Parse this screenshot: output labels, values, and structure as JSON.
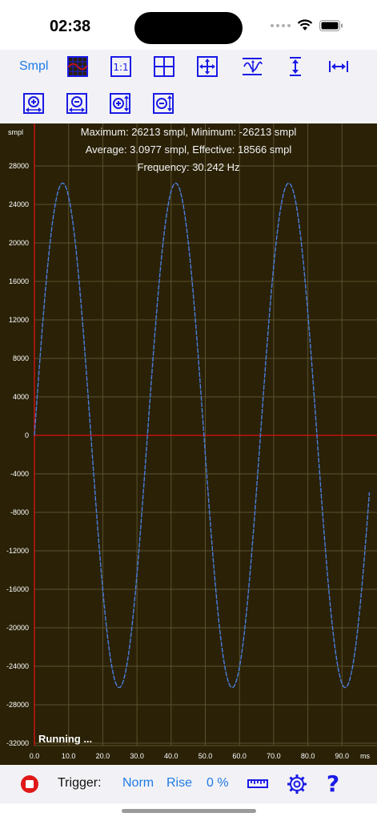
{
  "status": {
    "time": "02:38"
  },
  "toolbar": {
    "units_label": "Smpl"
  },
  "plot": {
    "unit_label": "smpl",
    "x_unit_label": "ms",
    "info_line_1": "Maximum: 26213 smpl, Minimum: -26213 smpl",
    "info_line_2": "Average: 3.0977 smpl, Effective: 18566 smpl",
    "info_line_3": "Frequency: 30.242 Hz",
    "status_text": "Running ..."
  },
  "bottom": {
    "trigger_label": "Trigger:",
    "mode": "Norm",
    "edge": "Rise",
    "level": "0 %"
  },
  "colors": {
    "background": "#2a2106",
    "grid": "#5a5230",
    "axis": "#e01010",
    "trace": "#4a7fe0",
    "accent": "#1a1ae6"
  },
  "chart_data": {
    "type": "line",
    "x_unit": "ms",
    "y_unit": "smpl",
    "xlim": [
      0,
      98
    ],
    "ylim": [
      -33000,
      33000
    ],
    "x_ticks": [
      0,
      10,
      20,
      30,
      40,
      50,
      60,
      70,
      80,
      90
    ],
    "x_tick_labels": [
      "0.0",
      "10.0",
      "20.0",
      "30.0",
      "40.0",
      "50.0",
      "60.0",
      "70.0",
      "80.0",
      "90.0"
    ],
    "y_ticks": [
      28000,
      24000,
      20000,
      16000,
      12000,
      8000,
      4000,
      0,
      -4000,
      -8000,
      -12000,
      -16000,
      -20000,
      -24000,
      -28000,
      -32000
    ],
    "y_tick_labels": [
      "28000",
      "24000",
      "20000",
      "16000",
      "12000",
      "8000",
      "4000",
      "0",
      "-4000",
      "-8000",
      "-12000",
      "-16000",
      "-20000",
      "-24000",
      "-28000",
      "-32000"
    ],
    "series": [
      {
        "waveform": "sine",
        "amplitude": 26213,
        "frequency_hz": 30.242,
        "phase_deg": 0
      }
    ],
    "grid": true
  }
}
